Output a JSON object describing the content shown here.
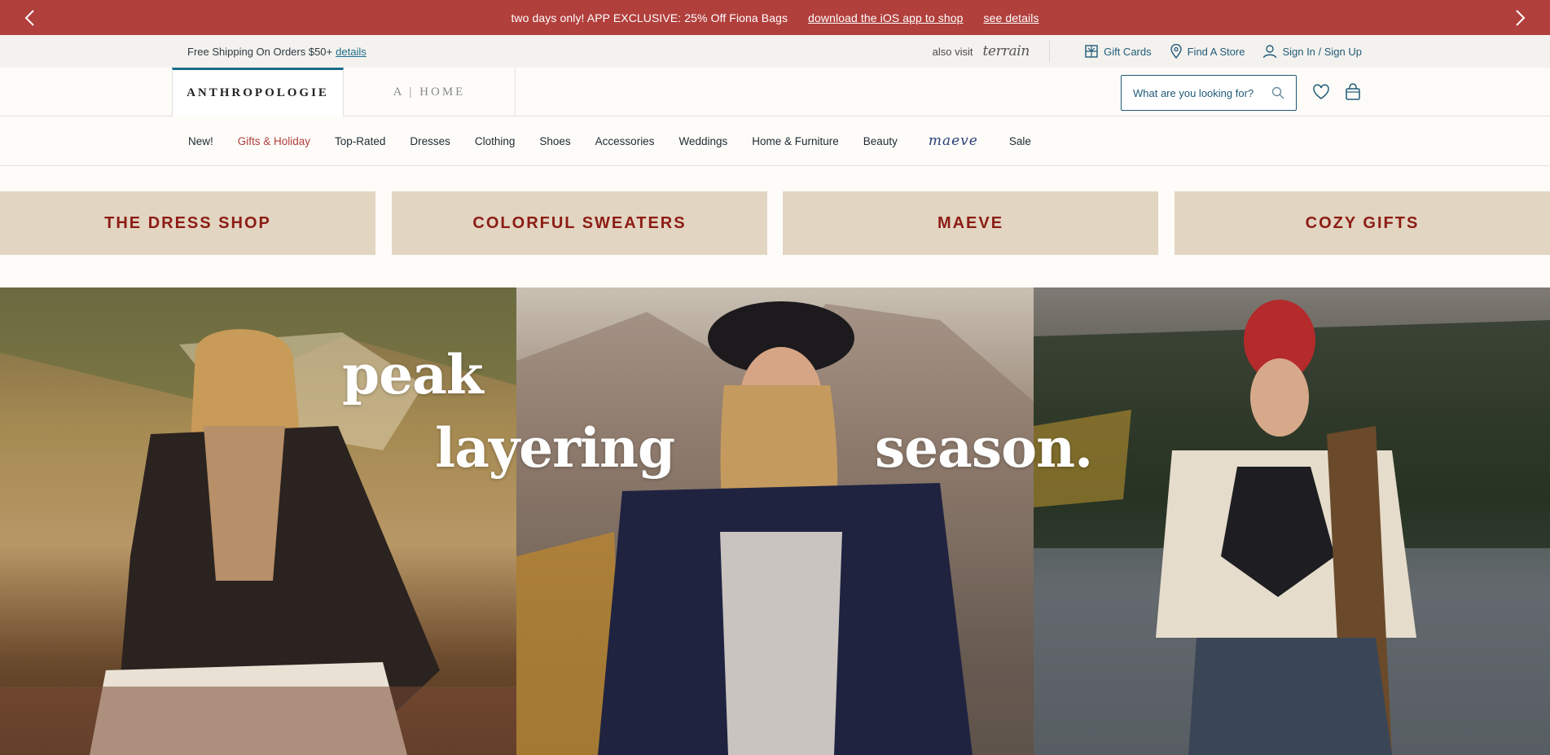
{
  "promo": {
    "message": "two days only! APP EXCLUSIVE: 25% Off Fiona Bags",
    "app_link": "download the iOS app to shop",
    "details_link": "see details",
    "background": "#b13f3c"
  },
  "utility": {
    "shipping": "Free Shipping On Orders $50+",
    "shipping_link": "details",
    "also_visit": "also visit",
    "terrain": "terrain",
    "gift_cards": "Gift Cards",
    "find_store": "Find A Store",
    "sign_in": "Sign In / Sign Up"
  },
  "header": {
    "brand": "ANTHROPOLOGIE",
    "home_brand": "A | HOME",
    "search_placeholder": "What are you looking for?",
    "accent": "#1b6b8a"
  },
  "nav": {
    "items": [
      "New!",
      "Gifts & Holiday",
      "Top-Rated",
      "Dresses",
      "Clothing",
      "Shoes",
      "Accessories",
      "Weddings",
      "Home & Furniture",
      "Beauty",
      "maeve",
      "Sale"
    ],
    "active_index": 1,
    "active_color": "#b13f3c"
  },
  "tiles": [
    "THE DRESS SHOP",
    "COLORFUL SWEATERS",
    "MAEVE",
    "COZY GIFTS"
  ],
  "hero": {
    "word1": "peak",
    "word2": "layering",
    "word3": "season."
  }
}
